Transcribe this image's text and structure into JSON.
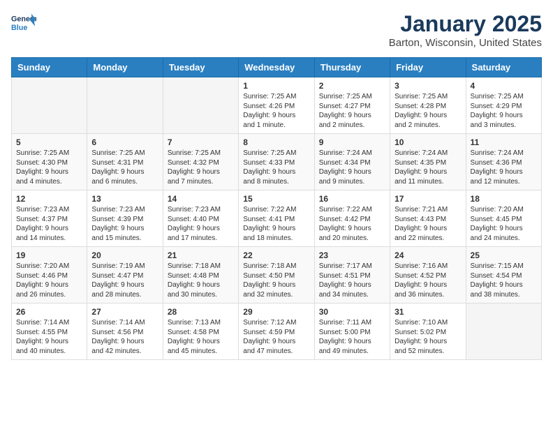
{
  "header": {
    "logo_line1": "General",
    "logo_line2": "Blue",
    "month": "January 2025",
    "location": "Barton, Wisconsin, United States"
  },
  "weekdays": [
    "Sunday",
    "Monday",
    "Tuesday",
    "Wednesday",
    "Thursday",
    "Friday",
    "Saturday"
  ],
  "weeks": [
    [
      {
        "day": "",
        "info": ""
      },
      {
        "day": "",
        "info": ""
      },
      {
        "day": "",
        "info": ""
      },
      {
        "day": "1",
        "info": "Sunrise: 7:25 AM\nSunset: 4:26 PM\nDaylight: 9 hours\nand 1 minute."
      },
      {
        "day": "2",
        "info": "Sunrise: 7:25 AM\nSunset: 4:27 PM\nDaylight: 9 hours\nand 2 minutes."
      },
      {
        "day": "3",
        "info": "Sunrise: 7:25 AM\nSunset: 4:28 PM\nDaylight: 9 hours\nand 2 minutes."
      },
      {
        "day": "4",
        "info": "Sunrise: 7:25 AM\nSunset: 4:29 PM\nDaylight: 9 hours\nand 3 minutes."
      }
    ],
    [
      {
        "day": "5",
        "info": "Sunrise: 7:25 AM\nSunset: 4:30 PM\nDaylight: 9 hours\nand 4 minutes."
      },
      {
        "day": "6",
        "info": "Sunrise: 7:25 AM\nSunset: 4:31 PM\nDaylight: 9 hours\nand 6 minutes."
      },
      {
        "day": "7",
        "info": "Sunrise: 7:25 AM\nSunset: 4:32 PM\nDaylight: 9 hours\nand 7 minutes."
      },
      {
        "day": "8",
        "info": "Sunrise: 7:25 AM\nSunset: 4:33 PM\nDaylight: 9 hours\nand 8 minutes."
      },
      {
        "day": "9",
        "info": "Sunrise: 7:24 AM\nSunset: 4:34 PM\nDaylight: 9 hours\nand 9 minutes."
      },
      {
        "day": "10",
        "info": "Sunrise: 7:24 AM\nSunset: 4:35 PM\nDaylight: 9 hours\nand 11 minutes."
      },
      {
        "day": "11",
        "info": "Sunrise: 7:24 AM\nSunset: 4:36 PM\nDaylight: 9 hours\nand 12 minutes."
      }
    ],
    [
      {
        "day": "12",
        "info": "Sunrise: 7:23 AM\nSunset: 4:37 PM\nDaylight: 9 hours\nand 14 minutes."
      },
      {
        "day": "13",
        "info": "Sunrise: 7:23 AM\nSunset: 4:39 PM\nDaylight: 9 hours\nand 15 minutes."
      },
      {
        "day": "14",
        "info": "Sunrise: 7:23 AM\nSunset: 4:40 PM\nDaylight: 9 hours\nand 17 minutes."
      },
      {
        "day": "15",
        "info": "Sunrise: 7:22 AM\nSunset: 4:41 PM\nDaylight: 9 hours\nand 18 minutes."
      },
      {
        "day": "16",
        "info": "Sunrise: 7:22 AM\nSunset: 4:42 PM\nDaylight: 9 hours\nand 20 minutes."
      },
      {
        "day": "17",
        "info": "Sunrise: 7:21 AM\nSunset: 4:43 PM\nDaylight: 9 hours\nand 22 minutes."
      },
      {
        "day": "18",
        "info": "Sunrise: 7:20 AM\nSunset: 4:45 PM\nDaylight: 9 hours\nand 24 minutes."
      }
    ],
    [
      {
        "day": "19",
        "info": "Sunrise: 7:20 AM\nSunset: 4:46 PM\nDaylight: 9 hours\nand 26 minutes."
      },
      {
        "day": "20",
        "info": "Sunrise: 7:19 AM\nSunset: 4:47 PM\nDaylight: 9 hours\nand 28 minutes."
      },
      {
        "day": "21",
        "info": "Sunrise: 7:18 AM\nSunset: 4:48 PM\nDaylight: 9 hours\nand 30 minutes."
      },
      {
        "day": "22",
        "info": "Sunrise: 7:18 AM\nSunset: 4:50 PM\nDaylight: 9 hours\nand 32 minutes."
      },
      {
        "day": "23",
        "info": "Sunrise: 7:17 AM\nSunset: 4:51 PM\nDaylight: 9 hours\nand 34 minutes."
      },
      {
        "day": "24",
        "info": "Sunrise: 7:16 AM\nSunset: 4:52 PM\nDaylight: 9 hours\nand 36 minutes."
      },
      {
        "day": "25",
        "info": "Sunrise: 7:15 AM\nSunset: 4:54 PM\nDaylight: 9 hours\nand 38 minutes."
      }
    ],
    [
      {
        "day": "26",
        "info": "Sunrise: 7:14 AM\nSunset: 4:55 PM\nDaylight: 9 hours\nand 40 minutes."
      },
      {
        "day": "27",
        "info": "Sunrise: 7:14 AM\nSunset: 4:56 PM\nDaylight: 9 hours\nand 42 minutes."
      },
      {
        "day": "28",
        "info": "Sunrise: 7:13 AM\nSunset: 4:58 PM\nDaylight: 9 hours\nand 45 minutes."
      },
      {
        "day": "29",
        "info": "Sunrise: 7:12 AM\nSunset: 4:59 PM\nDaylight: 9 hours\nand 47 minutes."
      },
      {
        "day": "30",
        "info": "Sunrise: 7:11 AM\nSunset: 5:00 PM\nDaylight: 9 hours\nand 49 minutes."
      },
      {
        "day": "31",
        "info": "Sunrise: 7:10 AM\nSunset: 5:02 PM\nDaylight: 9 hours\nand 52 minutes."
      },
      {
        "day": "",
        "info": ""
      }
    ]
  ]
}
